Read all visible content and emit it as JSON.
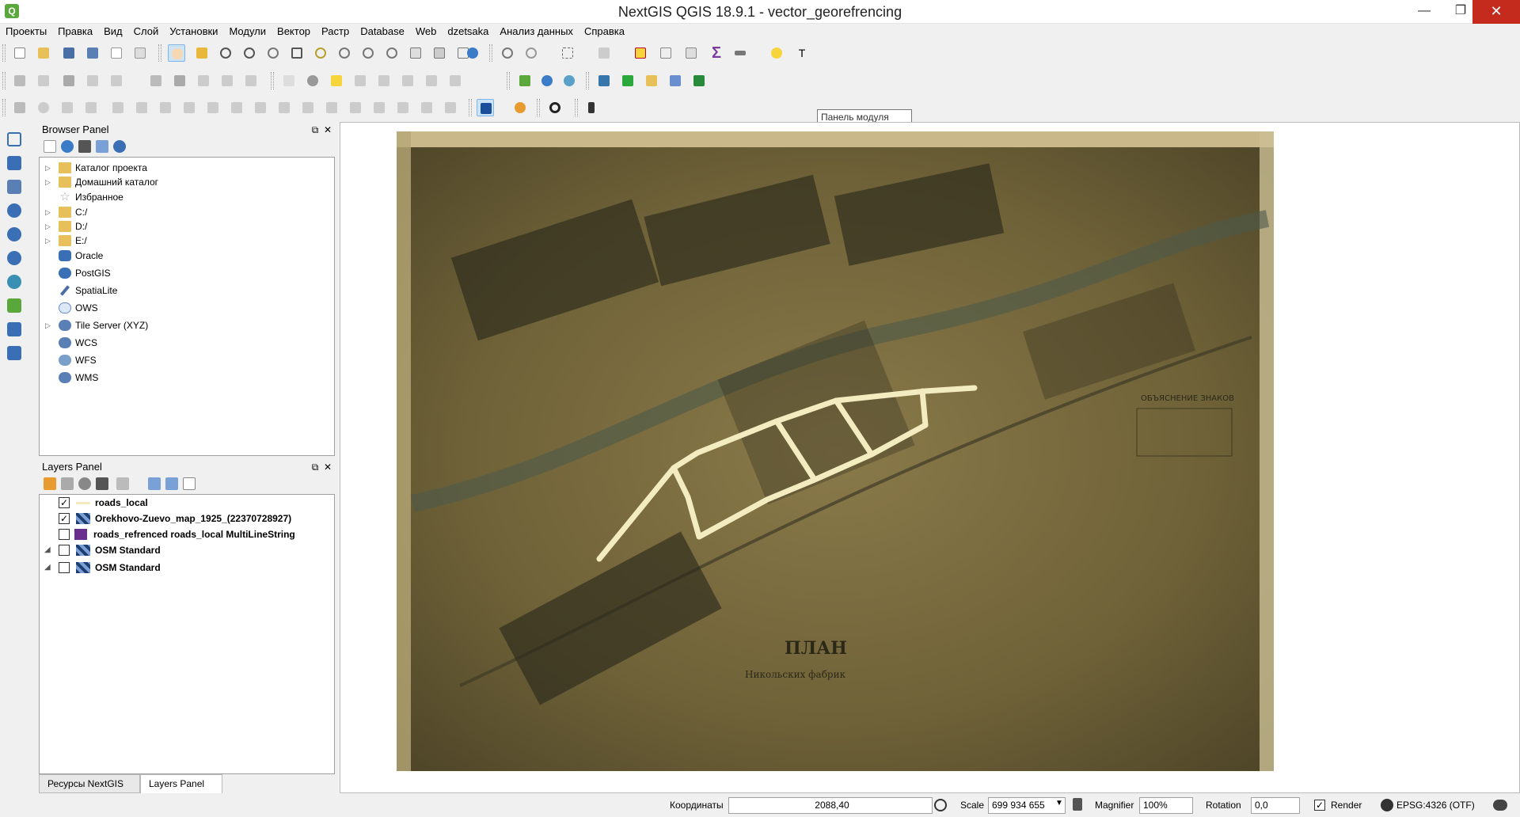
{
  "window": {
    "title": "NextGIS QGIS 18.9.1 - vector_georefrencing",
    "app_icon": "qgis-app-icon",
    "controls": [
      "minimize",
      "maximize",
      "close"
    ]
  },
  "menu": [
    "Проекты",
    "Правка",
    "Вид",
    "Слой",
    "Установки",
    "Модули",
    "Вектор",
    "Растр",
    "Database",
    "Web",
    "dzetsaka",
    "Анализ данных",
    "Справка"
  ],
  "tooltip": "Панель модуля",
  "browser_panel": {
    "title": "Browser Panel",
    "items": [
      {
        "label": "Каталог проекта",
        "icon": "folder-icon",
        "expandable": true
      },
      {
        "label": "Домашний каталог",
        "icon": "folder-icon",
        "expandable": true
      },
      {
        "label": "Избранное",
        "icon": "star-icon",
        "expandable": false
      },
      {
        "label": "C:/",
        "icon": "folder-icon",
        "expandable": true
      },
      {
        "label": "D:/",
        "icon": "folder-icon",
        "expandable": true
      },
      {
        "label": "E:/",
        "icon": "folder-icon",
        "expandable": true
      },
      {
        "label": "Oracle",
        "icon": "oracle-icon",
        "expandable": false
      },
      {
        "label": "PostGIS",
        "icon": "postgis-icon",
        "expandable": false
      },
      {
        "label": "SpatiaLite",
        "icon": "spatialite-icon",
        "expandable": false
      },
      {
        "label": "OWS",
        "icon": "ows-icon",
        "expandable": false
      },
      {
        "label": "Tile Server (XYZ)",
        "icon": "tile-server-icon",
        "expandable": true
      },
      {
        "label": "WCS",
        "icon": "wcs-icon",
        "expandable": false
      },
      {
        "label": "WFS",
        "icon": "wfs-icon",
        "expandable": false
      },
      {
        "label": "WMS",
        "icon": "wms-icon",
        "expandable": false
      }
    ]
  },
  "layers_panel": {
    "title": "Layers Panel",
    "layers": [
      {
        "label": "roads_local",
        "checked": true,
        "icon": "line-layer-icon",
        "group": false
      },
      {
        "label": "Orekhovo-Zuevo_map_1925_(22370728927)",
        "checked": true,
        "icon": "raster-layer-icon",
        "group": false
      },
      {
        "label": "roads_refrenced roads_local MultiLineString",
        "checked": false,
        "icon": "line-layer-icon",
        "group": false
      },
      {
        "label": "OSM Standard",
        "checked": false,
        "icon": "raster-layer-icon",
        "group": true
      },
      {
        "label": "OSM Standard",
        "checked": false,
        "icon": "raster-layer-icon",
        "group": true
      }
    ]
  },
  "bottom_tabs": [
    "Ресурсы NextGIS",
    "Layers Panel"
  ],
  "statusbar": {
    "coord_label": "Координаты",
    "coord_value": "2088,40",
    "scale_label": "Scale",
    "scale_value": "699 934 655",
    "magnifier_label": "Magnifier",
    "magnifier_value": "100%",
    "rotation_label": "Rotation",
    "rotation_value": "0,0",
    "render_label": "Render",
    "render_checked": true,
    "crs": "EPSG:4326 (OTF)"
  },
  "colors": {
    "road_overlay": "#f3ecc0",
    "map_paper": "#7d6c3f",
    "close_button": "#c42b1c",
    "folder": "#e8c05a"
  }
}
